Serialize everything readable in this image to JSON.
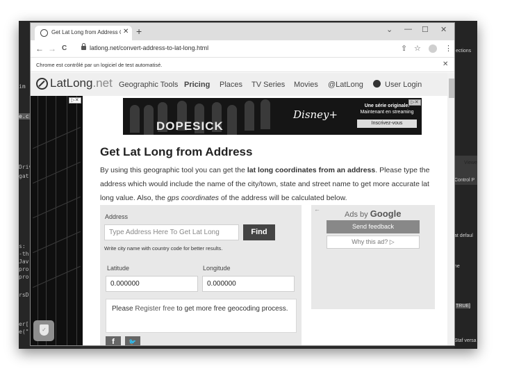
{
  "desktop": {
    "left_fragments": [
      "im",
      "e.c",
      "",
      "Driv",
      "gat",
      "",
      "s:",
      "-th",
      "Jav",
      "pro",
      "pro",
      "",
      "rsD",
      "",
      "er[",
      "e(\""
    ],
    "right_fragments": [
      "ections",
      "Viewe",
      "Control P",
      "at defaul",
      "ne",
      "TRUE]",
      "Staf versa"
    ]
  },
  "browser": {
    "tab_title": "Get Lat Long from Address Conv",
    "tab_close": "✕",
    "new_tab": "+",
    "window_controls": [
      "⌄",
      "—",
      "☐",
      "✕"
    ],
    "nav": {
      "back": "←",
      "forward": "→",
      "reload": "C"
    },
    "url": "latlong.net/convert-address-to-lat-long.html",
    "toolbar_icons": [
      "⇪",
      "☆",
      "⋮"
    ],
    "automation_notice": "Chrome est contrôlé par un logiciel de test automatisé.",
    "notice_close": "✕"
  },
  "site": {
    "logo": {
      "main": "LatLong",
      "suffix": ".net"
    },
    "nav": [
      "Geographic Tools",
      "Pricing",
      "Places",
      "TV Series",
      "Movies",
      "@LatLong"
    ],
    "user_login": "User Login"
  },
  "ads": {
    "ad_choices": "▷✕",
    "banner": {
      "title": "DOPESICK",
      "brand": "Disney+",
      "line1": "Une série originale.",
      "line2": "Maintenant en streaming",
      "cta": "Inscrivez-vous"
    },
    "shield": "✓"
  },
  "main": {
    "title": "Get Lat Long from Address",
    "intro": {
      "p1": "By using this geographic tool you can get the ",
      "b1": "lat long coordinates from an address",
      "p2": ". Please type the address which would include the name of the city/town, state and street name to get more accurate lat long value. Also, the ",
      "i1": "gps coordinates",
      "p3": " of the address will be calculated below."
    }
  },
  "form": {
    "address_label": "Address",
    "address_placeholder": "Type Address Here To Get Lat Long",
    "find_button": "Find",
    "hint": "Write city name with country code for better results.",
    "latitude_label": "Latitude",
    "longitude_label": "Longitude",
    "latitude_value": "0.000000",
    "longitude_value": "0.000000",
    "register": {
      "pre": "Please ",
      "link": "Register free",
      "post": " to get more free geocoding process."
    },
    "social": [
      "f",
      "🐦"
    ]
  },
  "google_ads": {
    "back": "←",
    "ads_by": "Ads by ",
    "google": "Google",
    "send_feedback": "Send feedback",
    "why_ad": "Why this ad? ▷"
  }
}
